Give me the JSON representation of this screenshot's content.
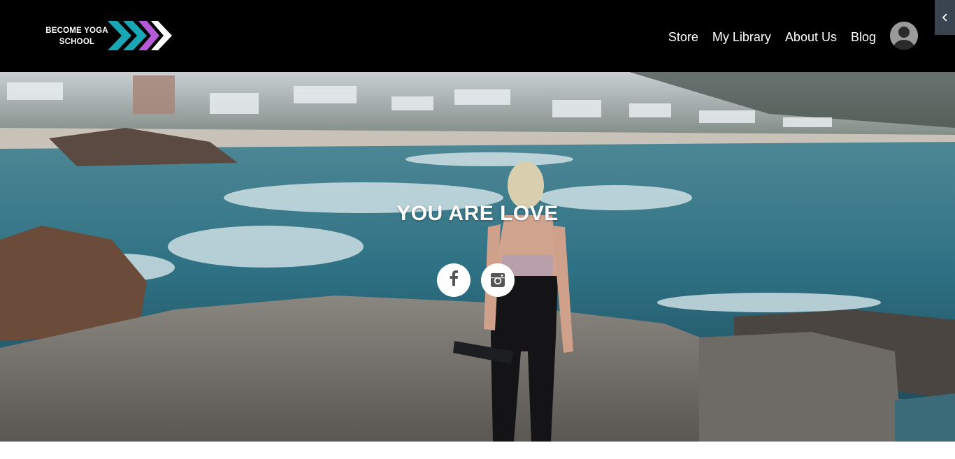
{
  "header": {
    "logo": {
      "line1": "BECOME YOGA",
      "line2": "SCHOOL"
    },
    "nav": [
      {
        "label": "Store"
      },
      {
        "label": "My Library"
      },
      {
        "label": "About Us"
      },
      {
        "label": "Blog"
      }
    ],
    "collapse_icon": "chevron-left-icon"
  },
  "hero": {
    "title": "YOU ARE LOVE",
    "social": [
      {
        "name": "facebook",
        "icon": "facebook-icon"
      },
      {
        "name": "instagram",
        "icon": "instagram-icon"
      }
    ]
  },
  "colors": {
    "header_bg": "#000000",
    "logo_teal": "#1aa7b5",
    "logo_purple": "#b55ad8",
    "logo_white": "#ffffff",
    "sea": "#2f7a8c",
    "rock": "#7d7a76"
  }
}
